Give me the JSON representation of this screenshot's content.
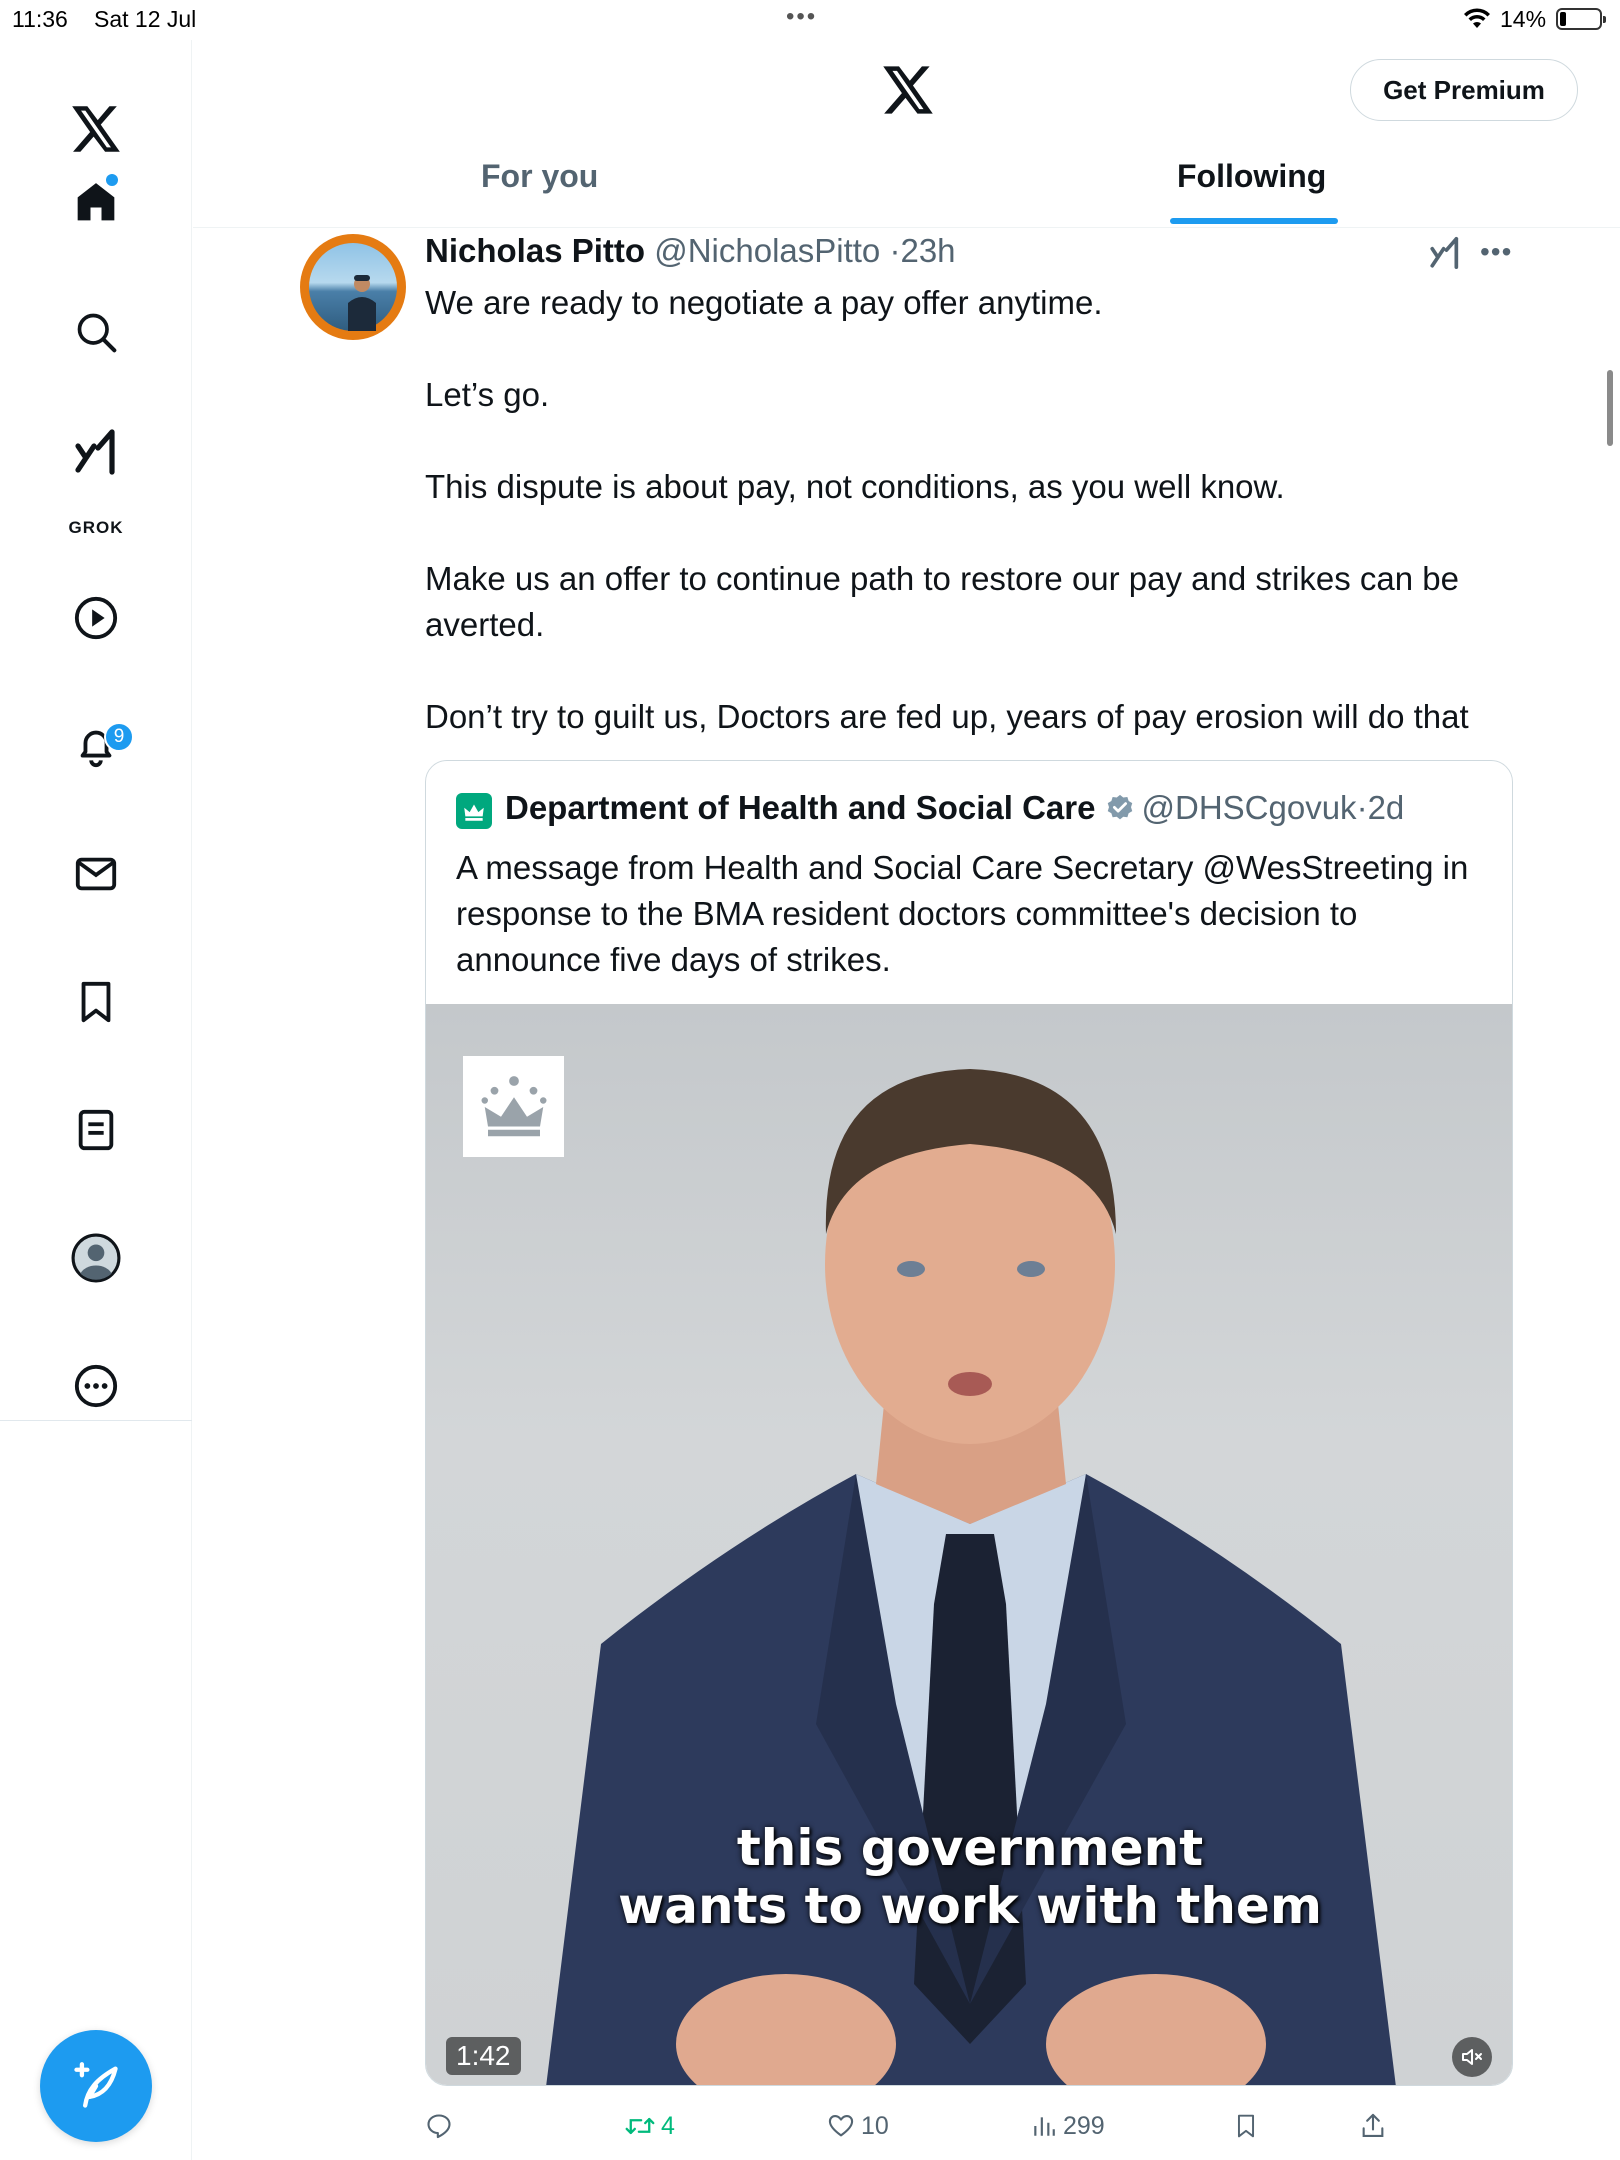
{
  "status_bar": {
    "time": "11:36",
    "date": "Sat 12 Jul",
    "battery": "14%"
  },
  "sidebar": {
    "items": [
      {
        "icon": "x-logo-icon"
      },
      {
        "icon": "home-icon",
        "active": true,
        "has_dot": true
      },
      {
        "icon": "search-icon"
      },
      {
        "icon": "grok-icon",
        "label": "GROK"
      },
      {
        "icon": "video-play-icon"
      },
      {
        "icon": "bell-icon",
        "badge": "9"
      },
      {
        "icon": "mail-icon"
      },
      {
        "icon": "bookmark-icon"
      },
      {
        "icon": "list-icon"
      },
      {
        "icon": "profile-avatar-icon"
      },
      {
        "icon": "more-circle-icon"
      }
    ],
    "compose_icon": "compose-feather-icon"
  },
  "header": {
    "premium_label": "Get Premium",
    "tabs": [
      {
        "label": "For you",
        "active": false
      },
      {
        "label": "Following",
        "active": true
      }
    ]
  },
  "post": {
    "author_name": "Nicholas Pitto",
    "handle": "@NicholasPitto",
    "separator": "·",
    "time": "23h",
    "paragraphs": [
      "We are ready to negotiate a pay offer anytime.",
      "Let’s go.",
      "This dispute is about pay, not conditions, as you well know.",
      "Make us an offer to continue path to restore our pay and strikes can be averted.",
      "Don’t try to guilt us, Doctors are fed up, years of pay erosion will do that"
    ],
    "quote": {
      "author_name": "Department of Health and Social Care",
      "handle": "@DHSCgovuk",
      "separator": "·",
      "time": "2d",
      "text": "A message from Health and Social Care Secretary @WesStreeting in response to the BMA resident doctors committee's decision to announce five days of strikes.",
      "video": {
        "caption_line1": "this government",
        "caption_line2": "wants to work with them",
        "duration": "1:42"
      }
    },
    "actions": {
      "reply_count": "",
      "retweet_count": "4",
      "like_count": "10",
      "views_count": "299"
    }
  },
  "colors": {
    "accent": "#1d9bf0",
    "retweet_green": "#00ba7c",
    "text_secondary": "#536471",
    "dhsc_green": "#00a87e"
  }
}
